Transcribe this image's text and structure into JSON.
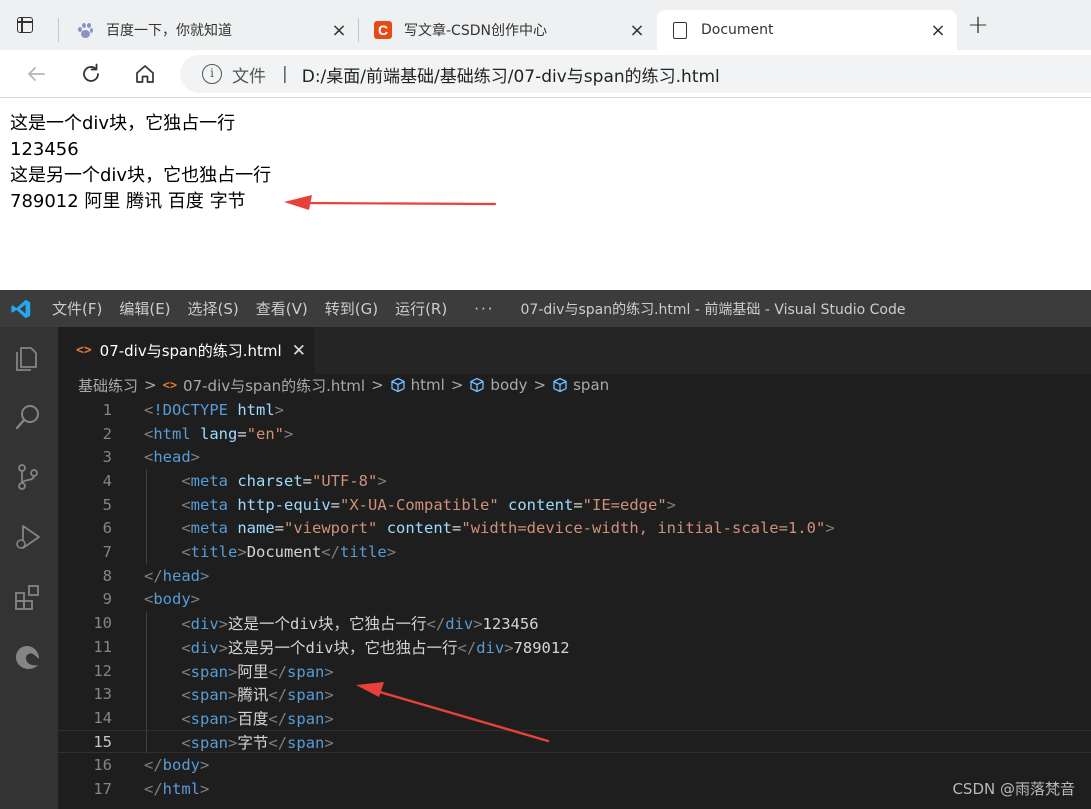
{
  "browser": {
    "tabs": [
      {
        "title": "百度一下，你就知道",
        "icon": "baidu-paw-icon",
        "active": false
      },
      {
        "title": "写文章-CSDN创作中心",
        "icon": "csdn-c-icon",
        "csdn_letter": "C",
        "active": false
      },
      {
        "title": "Document",
        "icon": "document-icon",
        "active": true
      }
    ],
    "close_glyph": "×",
    "new_tab_glyph": "+",
    "address": {
      "info_glyph": "i",
      "scheme_label": "文件",
      "separator": "|",
      "url": "D:/桌面/前端基础/基础练习/07-div与span的练习.html"
    }
  },
  "page_content": {
    "lines": [
      "这是一个div块，它独占一行",
      "123456",
      "这是另一个div块，它也独占一行",
      "789012 阿里 腾讯 百度 字节"
    ]
  },
  "vscode": {
    "menu": [
      "文件(F)",
      "编辑(E)",
      "选择(S)",
      "查看(V)",
      "转到(G)",
      "运行(R)"
    ],
    "more": "···",
    "window_title": "07-div与span的练习.html - 前端基础 - Visual Studio Code",
    "tab": {
      "icon": "<>",
      "title": "07-div与span的练习.html",
      "close": "✕"
    },
    "breadcrumb": {
      "folder": "基础练习",
      "file_icon": "<>",
      "file": "07-div与span的练习.html",
      "sep": ">",
      "symbols": [
        "html",
        "body",
        "span"
      ]
    },
    "line_numbers": [
      "1",
      "2",
      "3",
      "4",
      "5",
      "6",
      "7",
      "8",
      "9",
      "10",
      "11",
      "12",
      "13",
      "14",
      "15",
      "16",
      "17"
    ],
    "current_line": 15,
    "code": {
      "l1_doctype": "!DOCTYPE",
      "l1_html": "html",
      "html_tag": "html",
      "lang_attr": "lang",
      "lang_val": "\"en\"",
      "head_tag": "head",
      "meta_tag": "meta",
      "charset_attr": "charset",
      "charset_val": "\"UTF-8\"",
      "httpequiv_attr": "http-equiv",
      "httpequiv_val": "\"X-UA-Compatible\"",
      "content_attr": "content",
      "ie_val": "\"IE=edge\"",
      "name_attr": "name",
      "viewport_val": "\"viewport\"",
      "viewport_content_val": "\"width=device-width, initial-scale=1.0\"",
      "title_tag": "title",
      "title_text": "Document",
      "body_tag": "body",
      "div_tag": "div",
      "span_tag": "span",
      "div1_text": "这是一个div块，它独占一行",
      "div1_after": "123456",
      "div2_text": "这是另一个div块，它也独占一行",
      "div2_after": "789012",
      "span1": "阿里",
      "span2": "腾讯",
      "span3": "百度",
      "span4": "字节"
    }
  },
  "watermark": "CSDN @雨落梵音",
  "colors": {
    "annotation_arrow": "#e8413a",
    "vscode_bg": "#1e1e1e",
    "html_icon": "#e37933"
  }
}
